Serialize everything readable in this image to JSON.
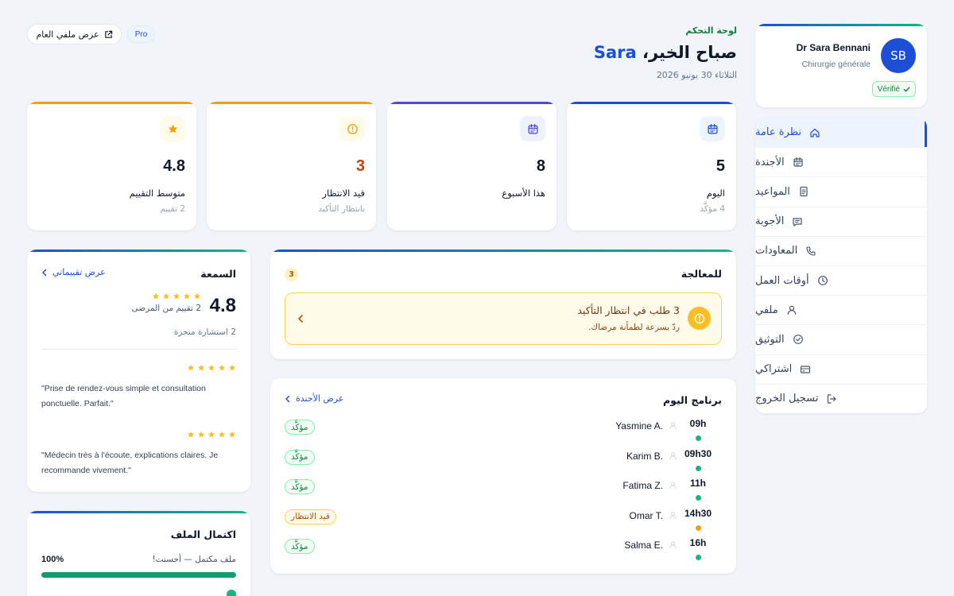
{
  "profile": {
    "initials": "SB",
    "name": "Dr Sara Bennani",
    "specialty": "Chirurgie générale",
    "verified_label": "Vérifié"
  },
  "nav": {
    "items": [
      {
        "label": "نظرة عامة",
        "icon": "home-icon",
        "active": true
      },
      {
        "label": "الأجندة",
        "icon": "calendar-icon"
      },
      {
        "label": "المواعيد",
        "icon": "document-icon"
      },
      {
        "label": "الأجوبة",
        "icon": "message-icon"
      },
      {
        "label": "المعاودات",
        "icon": "phone-icon"
      },
      {
        "label": "أوقات العمل",
        "icon": "clock-icon"
      },
      {
        "label": "ملفي",
        "icon": "user-icon"
      },
      {
        "label": "التوثيق",
        "icon": "check-circle-icon"
      },
      {
        "label": "اشتراكي",
        "icon": "card-icon"
      },
      {
        "label": "تسجيل الخروج",
        "icon": "logout-icon"
      }
    ]
  },
  "header": {
    "breadcrumb": "لوحة التحكم",
    "greeting": "صباح الخير،",
    "greeting_name": "Sara",
    "date": "الثلاثاء 30 يونيو 2026",
    "pro_badge": "Pro",
    "public_profile_button": "عرض ملفي العام"
  },
  "stats": [
    {
      "value": "5",
      "label": "اليوم",
      "sub": "4 مؤكَّد",
      "icon": "calendar-icon",
      "accent": "#1d4ed8",
      "icon_bg": "#eef4ff",
      "value_color": "#0f172a"
    },
    {
      "value": "8",
      "label": "هذا الأسبوع",
      "sub": "",
      "icon": "calendar-icon",
      "accent": "#4f46e5",
      "icon_bg": "#eef2ff",
      "value_color": "#0f172a"
    },
    {
      "value": "3",
      "label": "قيد الانتظار",
      "sub": "بانتظار التأكيد",
      "icon": "alert-circle-icon",
      "accent": "#f59e0b",
      "icon_bg": "#fffbeb",
      "value_color": "#c2410c"
    },
    {
      "value": "4.8",
      "label": "متوسط التقييم",
      "sub": "2 تقييم",
      "icon": "star-icon",
      "accent": "#f59e0b",
      "icon_bg": "#fffbeb",
      "value_color": "#0f172a"
    }
  ],
  "processing": {
    "title": "للمعالجة",
    "count": "3",
    "alert_title": "3 طلب في انتظار التأكيد",
    "alert_sub": "ردّ بسرعة لطمأنة مرضاك."
  },
  "schedule": {
    "title": "برنامج اليوم",
    "link": "عرض الأجندة",
    "rows": [
      {
        "time": "09h",
        "patient": "Yasmine A.",
        "status": "مؤكَّد",
        "kind": "ok"
      },
      {
        "time": "09h30",
        "patient": "Karim B.",
        "status": "مؤكَّد",
        "kind": "ok"
      },
      {
        "time": "11h",
        "patient": "Fatima Z.",
        "status": "مؤكَّد",
        "kind": "ok"
      },
      {
        "time": "14h30",
        "patient": "Omar T.",
        "status": "قيد الانتظار",
        "kind": "wait"
      },
      {
        "time": "16h",
        "patient": "Salma E.",
        "status": "مؤكَّد",
        "kind": "ok"
      }
    ]
  },
  "reputation": {
    "title": "السمعة",
    "link": "عرض تقييماتي",
    "score": "4.8",
    "stars": 5,
    "count_text": "2 تقييم من المرضى",
    "consultations": "2 استشارة منجزة",
    "reviews": [
      {
        "stars": 5,
        "text": "\"Prise de rendez-vous simple et consultation ponctuelle. Parfait.\""
      },
      {
        "stars": 5,
        "text": "\"Médecin très à l'écoute, explications claires. Je recommande vivement.\""
      }
    ]
  },
  "completion": {
    "title": "اكتمال الملف",
    "status_text": "ملف مكتمل — أحسنت!",
    "percent_label": "100%",
    "percent": 1.0
  },
  "colors": {
    "primary": "#1d4ed8",
    "success": "#10b981",
    "warning": "#f59e0b",
    "accent_green": "#0f9d6e"
  }
}
